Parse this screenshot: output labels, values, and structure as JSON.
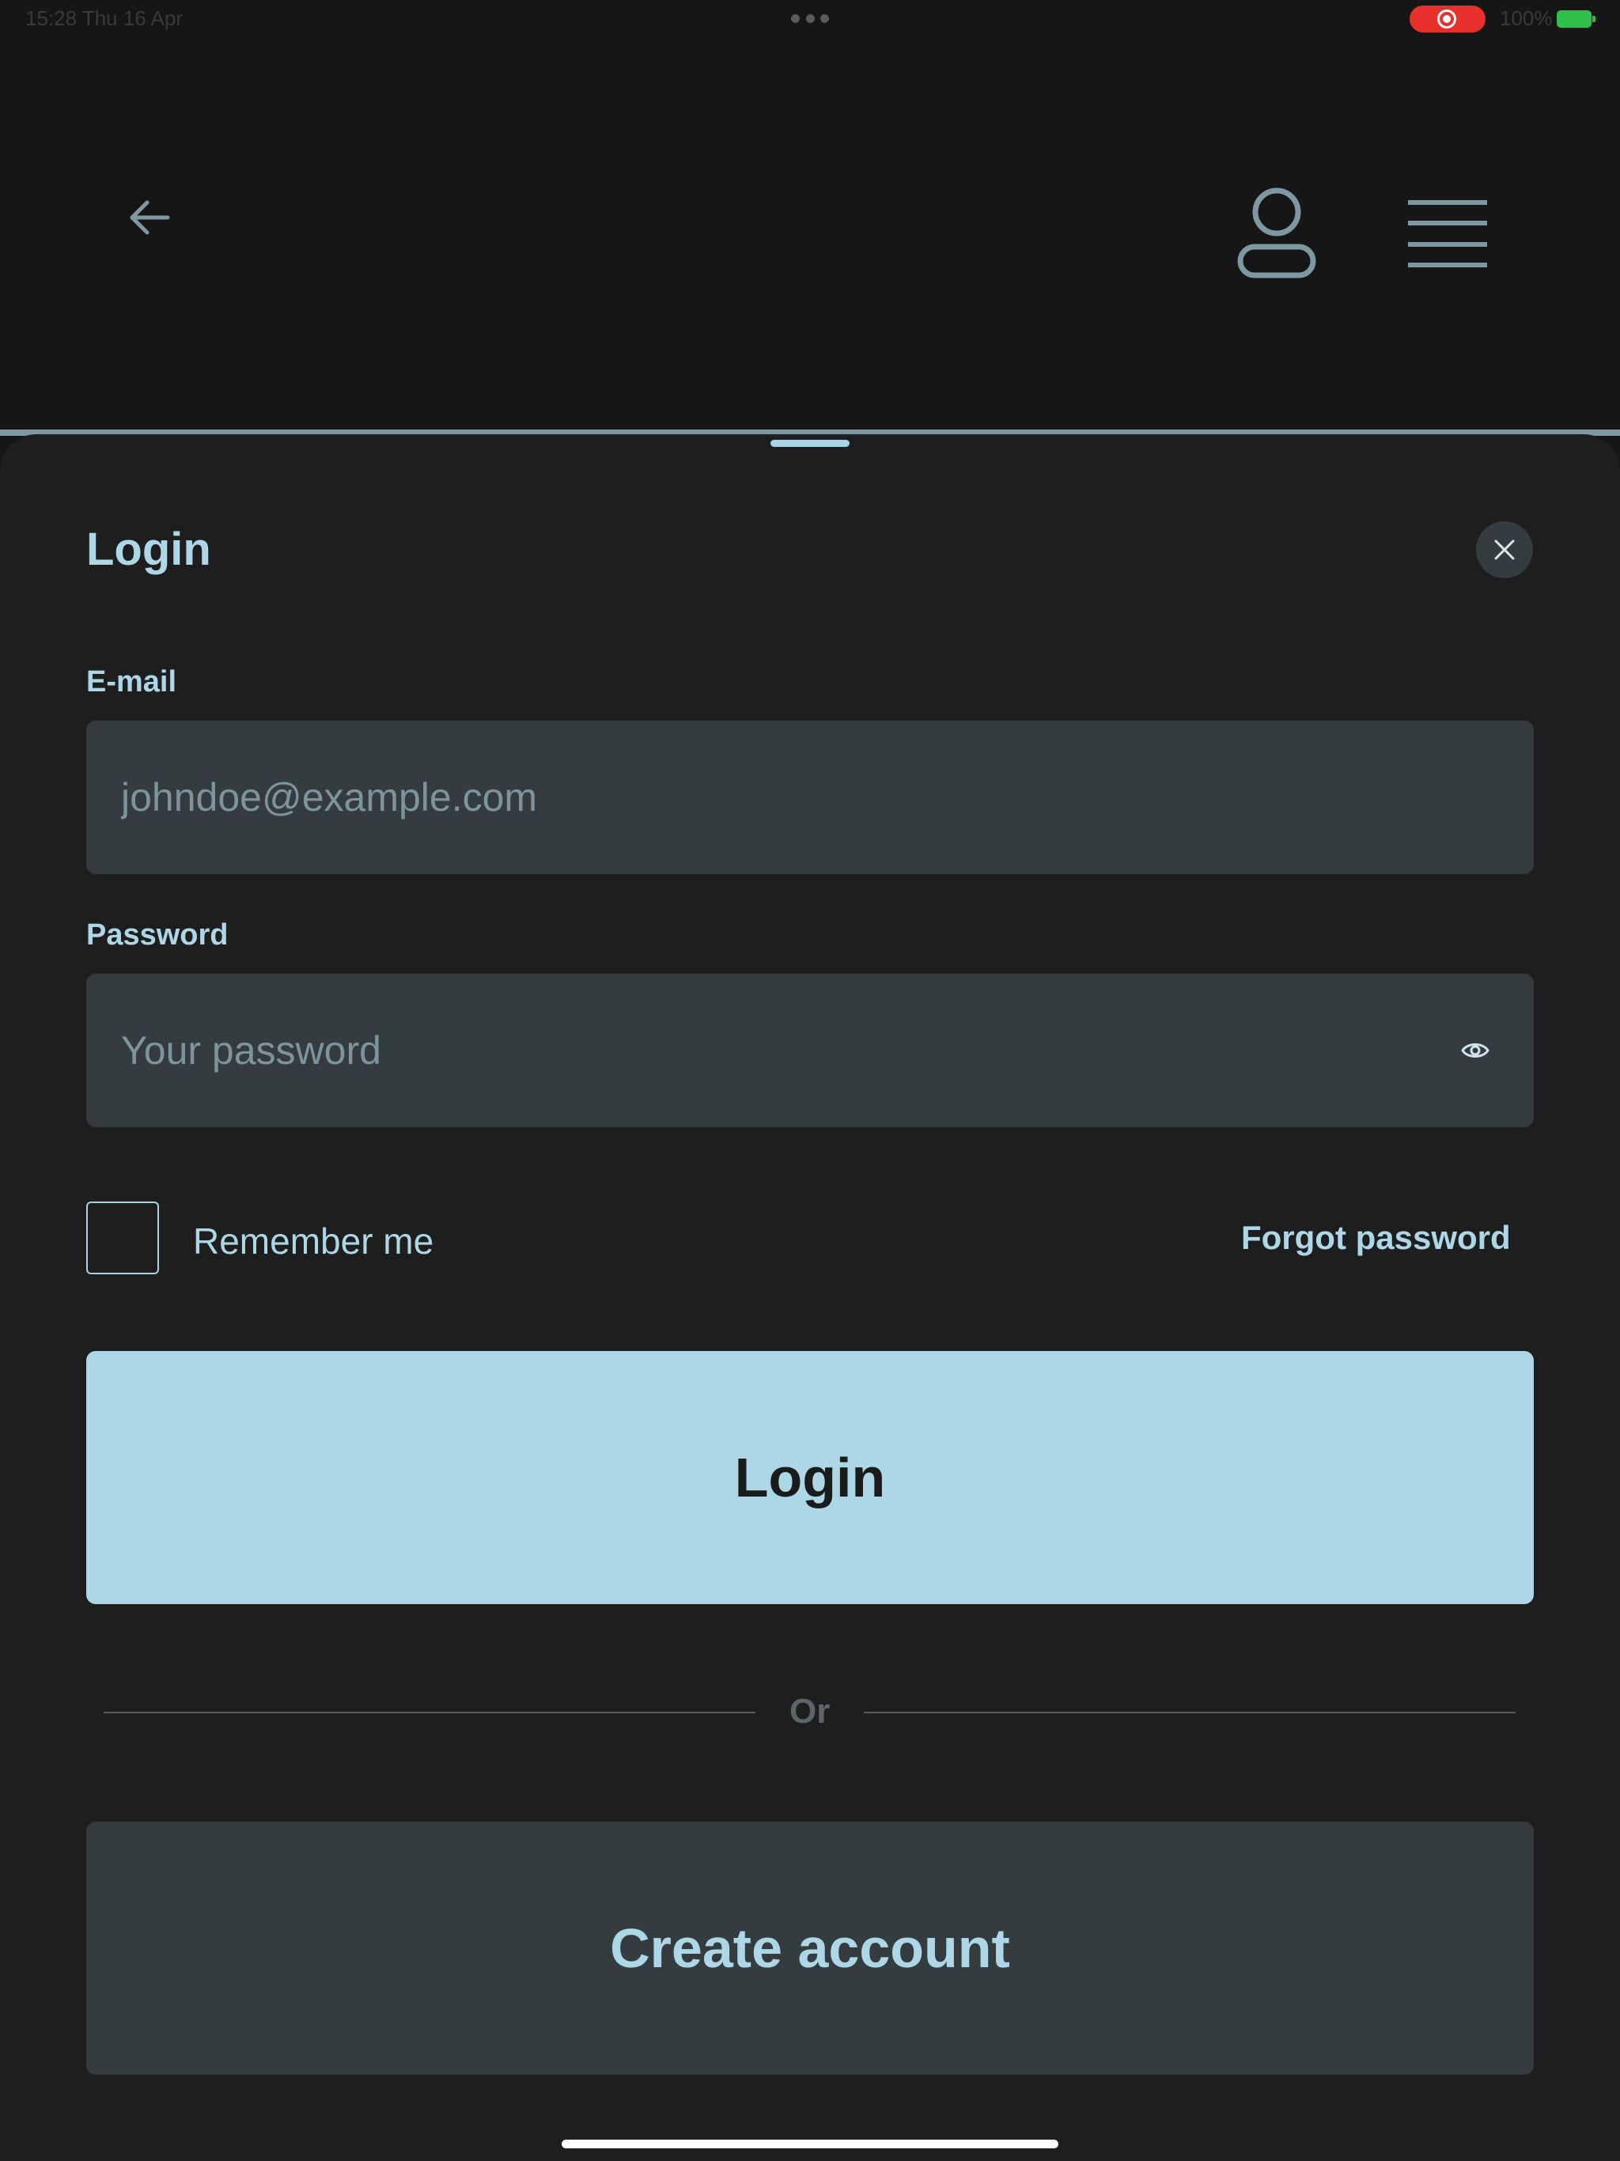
{
  "status_bar": {
    "time": "15:28  Thu 16 Apr",
    "battery": "100%"
  },
  "header": {
    "back_icon": "arrow-left-icon",
    "profile_icon": "user-icon",
    "menu_icon": "hamburger-menu-icon"
  },
  "sheet": {
    "title": "Login",
    "email": {
      "label": "E-mail",
      "placeholder": "johndoe@example.com",
      "value": ""
    },
    "password": {
      "label": "Password",
      "placeholder": "Your password",
      "value": ""
    },
    "remember_me": {
      "label": "Remember me",
      "checked": false
    },
    "forgot_password": "Forgot password",
    "login_button": "Login",
    "divider_text": "Or",
    "create_account_button": "Create account"
  },
  "colors": {
    "accent": "#add7e6",
    "background": "#161616",
    "sheet": "#1e1e1e",
    "input": "#353c40",
    "record": "#e8302c",
    "battery": "#2fbf4a"
  }
}
